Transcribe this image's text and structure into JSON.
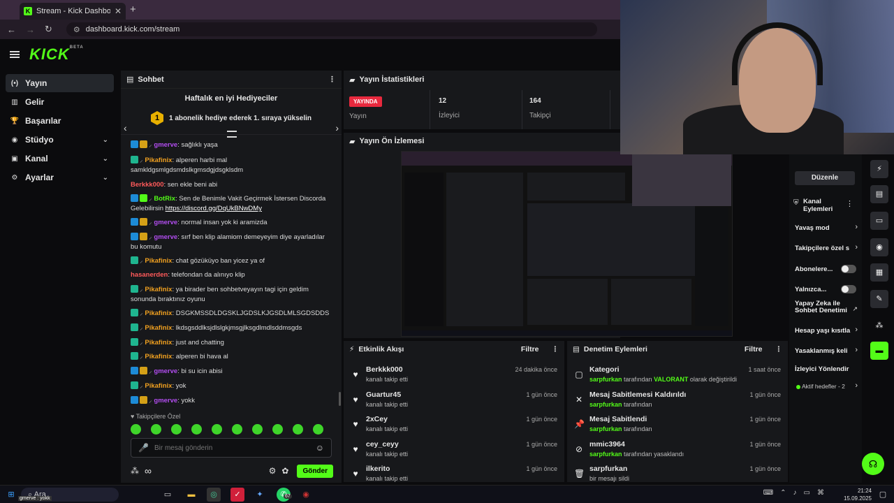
{
  "browser": {
    "tab_title": "Stream - Kick Dashboard",
    "url": "dashboard.kick.com/stream"
  },
  "brand": {
    "logo": "KICK",
    "beta": "BETA",
    "accent": "#53fc18"
  },
  "sidebar": {
    "items": [
      {
        "label": "Yayın",
        "icon": "broadcast-icon",
        "glyph": "(•)"
      },
      {
        "label": "Gelir",
        "icon": "revenue-icon",
        "glyph": "▥"
      },
      {
        "label": "Başarılar",
        "icon": "trophy-icon",
        "glyph": "🏆"
      },
      {
        "label": "Stüdyo",
        "icon": "studio-icon",
        "glyph": "◉"
      },
      {
        "label": "Kanal",
        "icon": "channel-icon",
        "glyph": "▣"
      },
      {
        "label": "Ayarlar",
        "icon": "gear-icon",
        "glyph": "⚙"
      }
    ]
  },
  "chat": {
    "title": "Sohbet",
    "gifters_title": "Haftalık en iyi Hediyeciler",
    "gifters_rank": "1",
    "gifters_text": "1 abonelik hediye ederek 1. sıraya yükselin",
    "messages": [
      {
        "user": "gmerve",
        "color": "#b24df0",
        "text": ": sağlıklı yaşa",
        "badges": [
          "b1",
          "b2"
        ]
      },
      {
        "user": "Pikafinix",
        "color": "#f0a020",
        "text": ": alperen harbi mal samkldgsmlgdsmdslkgmsdgjdsgklsdm",
        "badges": [
          "b3"
        ]
      },
      {
        "user": "Berkkk000",
        "color": "#ff5a5a",
        "text": ": sen ekle beni abi",
        "badges": []
      },
      {
        "user": "BotRix",
        "color": "#53fc18",
        "text": ": Sen de Benimle Vakit Geçirmek İstersen Discorda Gelebilirsin ",
        "link": "https://discord.gg/DqUkBNwDMy",
        "badges": [
          "b1",
          "b4"
        ]
      },
      {
        "user": "gmerve",
        "color": "#b24df0",
        "text": ": normal insan yok ki aramizda",
        "badges": [
          "b1",
          "b2"
        ]
      },
      {
        "user": "gmerve",
        "color": "#b24df0",
        "text": ": sırf ben klip alamiom demeyeyim diye ayarladılar bu komutu",
        "badges": [
          "b1",
          "b2"
        ]
      },
      {
        "user": "Pikafinix",
        "color": "#f0a020",
        "text": ": chat gözüküyo ban yicez ya of",
        "badges": [
          "b3"
        ]
      },
      {
        "user": "hasanerden",
        "color": "#ff5a5a",
        "text": ": telefondan da alınıyo klip",
        "badges": []
      },
      {
        "user": "Pikafinix",
        "color": "#f0a020",
        "text": ": ya birader ben sohbetveyayın tagi için geldim sonunda bıraktınız oyunu",
        "badges": [
          "b3"
        ]
      },
      {
        "user": "Pikafinix",
        "color": "#f0a020",
        "text": ": DSGKMSSDLDGSKLJGDSLKJGSDLMLSGDSDDS",
        "badges": [
          "b3"
        ]
      },
      {
        "user": "Pikafinix",
        "color": "#f0a020",
        "text": ": lkdsgsddlksjdlslgkjmsgjlksgdlmdlsddmsgds",
        "badges": [
          "b3"
        ]
      },
      {
        "user": "Pikafinix",
        "color": "#f0a020",
        "text": ": just and chatting",
        "badges": [
          "b3"
        ]
      },
      {
        "user": "Pikafinix",
        "color": "#f0a020",
        "text": ": alperen bi hava al",
        "badges": [
          "b3"
        ]
      },
      {
        "user": "gmerve",
        "color": "#b24df0",
        "text": ": bi su icin abisi",
        "badges": [
          "b1",
          "b2"
        ]
      },
      {
        "user": "Pikafinix",
        "color": "#f0a020",
        "text": ": yok",
        "badges": [
          "b3"
        ]
      },
      {
        "user": "gmerve",
        "color": "#b24df0",
        "text": ": yokk",
        "badges": [
          "b1",
          "b2"
        ]
      }
    ],
    "emote_label": "♥ Takipçilere Özel",
    "input_placeholder": "Bir mesaj gönderin",
    "send_label": "Gönder",
    "infinity": "∞"
  },
  "stats": {
    "title": "Yayın İstatistikleri",
    "live_badge": "YAYINDA",
    "live_label": "Yayın",
    "viewers_value": "12",
    "viewers_label": "İzleyici",
    "followers_value": "164",
    "followers_label": "Takipçi"
  },
  "preview": {
    "title": "Yayın Ön İzlemesi"
  },
  "activity": {
    "title": "Etkinlik Akışı",
    "filter": "Filtre",
    "rows": [
      {
        "name": "Berkkk000",
        "sub": "kanalı takip etti",
        "time": "24 dakika önce"
      },
      {
        "name": "Guartur45",
        "sub": "kanalı takip etti",
        "time": "1 gün önce"
      },
      {
        "name": "2xCey",
        "sub": "kanalı takip etti",
        "time": "1 gün önce"
      },
      {
        "name": "cey_ceyy",
        "sub": "kanalı takip etti",
        "time": "1 gün önce"
      },
      {
        "name": "ilkerito",
        "sub": "kanalı takip etti",
        "time": "1 gün önce"
      }
    ]
  },
  "moderation": {
    "title": "Denetim Eylemleri",
    "filter": "Filtre",
    "rows": [
      {
        "name": "Kategori",
        "user": "sarpfurkan",
        "mid": " tarafından ",
        "extra": "VALORANT",
        "end": " olarak değiştirildi",
        "time": "1 saat önce",
        "icon": "category-icon",
        "glyph": "▢"
      },
      {
        "name": "Mesaj Sabitlemesi Kaldırıldı",
        "user": "sarpfurkan",
        "mid": " tarafından",
        "extra": "",
        "end": "",
        "time": "1 gün önce",
        "icon": "unpin-icon",
        "glyph": "✕"
      },
      {
        "name": "Mesaj Sabitlendi",
        "user": "sarpfurkan",
        "mid": " tarafından",
        "extra": "",
        "end": "",
        "time": "1 gün önce",
        "icon": "pin-icon",
        "glyph": "📌"
      },
      {
        "name": "mmic3964",
        "user": "sarpfurkan",
        "mid": " tarafından yasaklandı",
        "extra": "",
        "end": "",
        "time": "1 gün önce",
        "icon": "ban-icon",
        "glyph": "⊘"
      },
      {
        "name": "sarpfurkan",
        "user": "",
        "mid": "bir mesajı sildi",
        "extra": "",
        "end": "",
        "time": "1 gün önce",
        "icon": "trash-icon",
        "glyph": "🗑"
      }
    ]
  },
  "right_panel": {
    "edit": "Düzenle",
    "channel_actions": "Kanal Eylemleri",
    "slow_mode": "Yavaş mod",
    "followers_only": "Takipçilere özel s",
    "subscribers": "Abonelere...",
    "only": "Yalnızca...",
    "ai_moderation": "Yapay Zeka ile Sohbet Denetimi",
    "account_age": "Hesap yaşı kısıtla",
    "banned_words": "Yasaklanmış keli",
    "viewer_redirect": "İzleyici Yönlendir",
    "active_goals": "Aktif hedefler - 2"
  },
  "taskbar": {
    "search": "Ara",
    "chat_popup": "gmerve : yokk",
    "whatsapp_badge": "67",
    "time": "21:24",
    "date": "15.09.2025"
  }
}
